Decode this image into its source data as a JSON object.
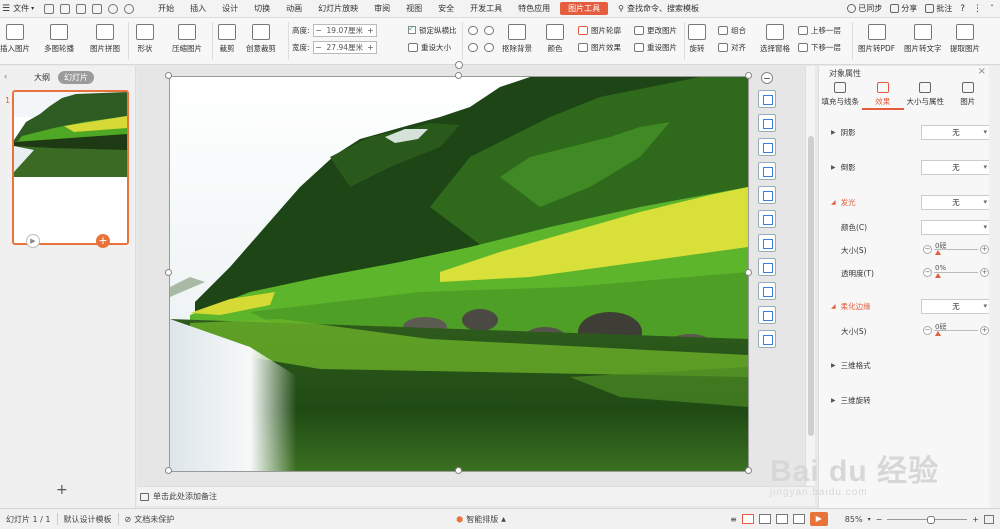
{
  "menu": {
    "file": "文件",
    "tabs": [
      "开始",
      "插入",
      "设计",
      "切换",
      "动画",
      "幻灯片放映",
      "审阅",
      "视图",
      "安全",
      "开发工具",
      "特色应用",
      "图片工具"
    ],
    "active_tab": "图片工具",
    "search": "查找命令、搜索模板",
    "sync": "已同步",
    "share": "分享",
    "annotate": "批注"
  },
  "ribbon": {
    "insert_picture": "插入图片",
    "multi_outline": "多图轮播",
    "picture_collage": "图片拼图",
    "shape": "形状",
    "compress": "压缩图片",
    "crop": "裁剪",
    "creative_crop": "创意裁剪",
    "height_label": "高度:",
    "height_value": "19.07厘米",
    "width_label": "宽度:",
    "width_value": "27.94厘米",
    "lock_ratio": "锁定纵横比",
    "reset_size": "重设大小",
    "remove_bg": "抠除背景",
    "color": "颜色",
    "pic_outline": "图片轮廓",
    "pic_effect": "图片效果",
    "change_pic": "更改图片",
    "reset_pic": "重设图片",
    "rotate": "旋转",
    "group": "组合",
    "align": "对齐",
    "select_pane": "选择窗格",
    "bring_forward": "上移一层",
    "send_backward": "下移一层",
    "pic_to_pdf": "图片转PDF",
    "pic_to_text": "图片转文字",
    "extract_pic": "提取图片"
  },
  "left_panel": {
    "outline_tab": "大纲",
    "slides_tab": "幻灯片",
    "slide_number": "1"
  },
  "notes": {
    "placeholder": "单击此处添加备注"
  },
  "right_panel": {
    "title": "对象属性",
    "tabs": [
      "填充与线条",
      "效果",
      "大小与属性",
      "图片"
    ],
    "active_tab": "效果",
    "shadow": "阴影",
    "shadow_value": "无",
    "reflection": "倒影",
    "reflection_value": "无",
    "glow": "发光",
    "glow_value": "无",
    "glow_color": "颜色(C)",
    "glow_size": "大小(S)",
    "glow_size_value": "0磅",
    "glow_transparency": "透明度(T)",
    "glow_transparency_value": "0%",
    "soft_edges": "柔化边缘",
    "soft_edges_value": "无",
    "soft_size": "大小(S)",
    "soft_size_value": "0磅",
    "three_d_format": "三维格式",
    "three_d_rotation": "三维旋转"
  },
  "status": {
    "slide_counter": "幻灯片 1 / 1",
    "design_template": "默认设计模板",
    "doc_protect": "文档未保护",
    "smart_layout": "智能排版",
    "zoom": "85%"
  },
  "watermark": {
    "brand": "Bai du 经验",
    "url": "jingyan.baidu.com"
  },
  "colors": {
    "accent": "#e35d3e",
    "accent_orange": "#e8743b"
  }
}
